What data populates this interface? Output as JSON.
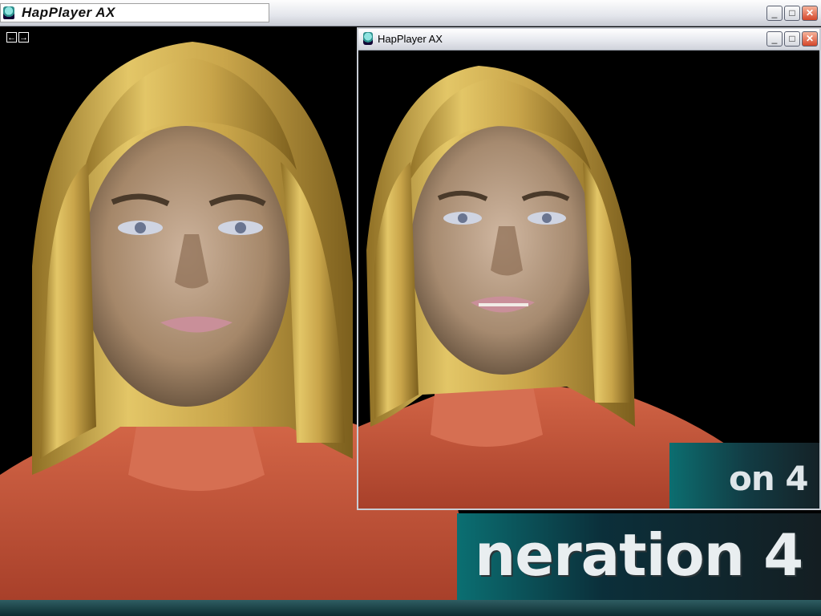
{
  "main_window": {
    "title": "HapPlayer AX",
    "controls": {
      "minimize": "_",
      "maximize": "□",
      "close": "✕"
    },
    "nav": {
      "back_icon": "←",
      "forward_icon": "→"
    },
    "banner_text": "neration 4"
  },
  "popup_window": {
    "title": "HapPlayer AX",
    "controls": {
      "minimize": "_",
      "maximize": "□",
      "close": "✕"
    },
    "banner_text": "on 4"
  },
  "colors": {
    "skin_suit": "#c8573a",
    "hair": "#d2b24a",
    "face": "#b89a7d",
    "background": "#000000",
    "banner": "#0b6f72"
  }
}
